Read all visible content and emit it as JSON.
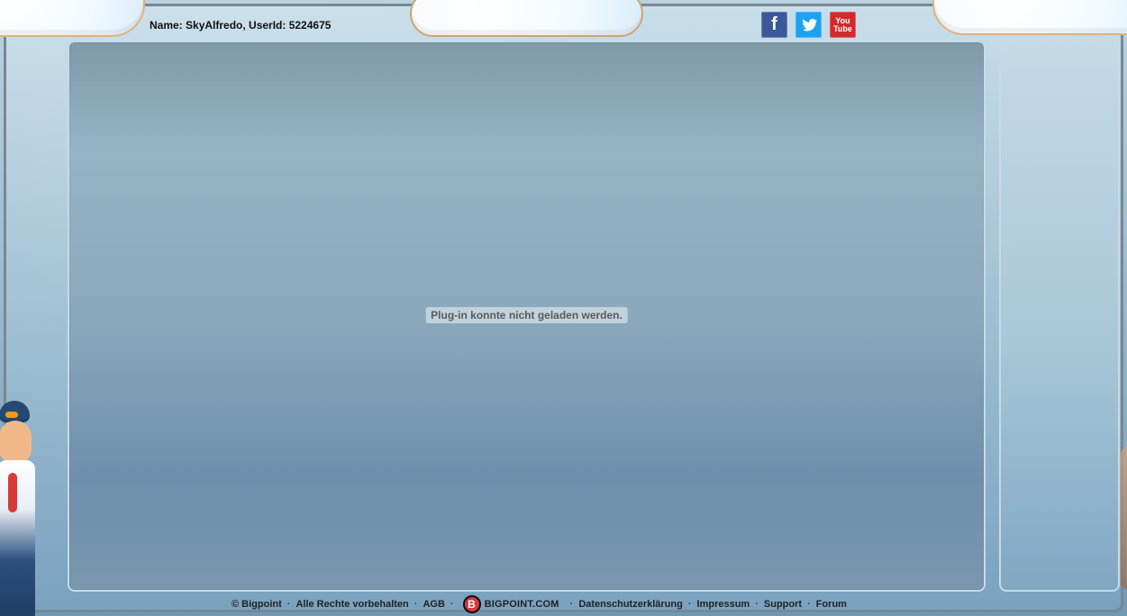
{
  "header": {
    "user_info": "Name: SkyAlfredo, UserId: 5224675"
  },
  "social": {
    "facebook_label": "f",
    "youtube_line1": "You",
    "youtube_line2": "Tube"
  },
  "main": {
    "plugin_message": "Plug-in konnte nicht geladen werden."
  },
  "footer": {
    "copyright": "© Bigpoint",
    "rights": "Alle Rechte vorbehalten",
    "agb": "AGB",
    "brand": "BIGPOINT.COM",
    "privacy": "Datenschutzerklärung",
    "imprint": "Impressum",
    "support": "Support",
    "forum": "Forum",
    "separator": "·"
  }
}
